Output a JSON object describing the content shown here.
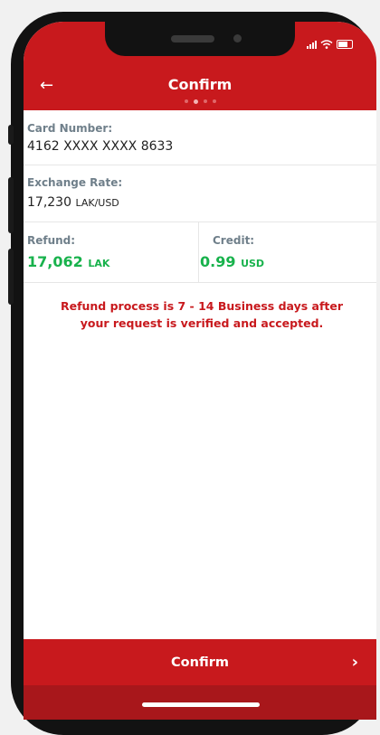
{
  "header": {
    "title": "Confirm",
    "back_icon": "←",
    "pager_dots": 4,
    "pager_active_index": 1
  },
  "card": {
    "label": "Card Number:",
    "value": "4162 XXXX XXXX 8633"
  },
  "exchange": {
    "label": "Exchange Rate:",
    "value": "17,230",
    "unit": "LAK/USD"
  },
  "refund": {
    "label": "Refund:",
    "value": "17,062",
    "unit": "LAK"
  },
  "credit": {
    "label": "Credit:",
    "value": "0.99",
    "unit": "USD"
  },
  "notice": "Refund process is 7 - 14 Business days after your request is verified and accepted.",
  "footer": {
    "confirm_label": "Confirm",
    "chevron_icon": "›"
  },
  "colors": {
    "brand_red": "#c8191d",
    "amount_green": "#18b24c",
    "label_gray": "#6f7f8a"
  }
}
